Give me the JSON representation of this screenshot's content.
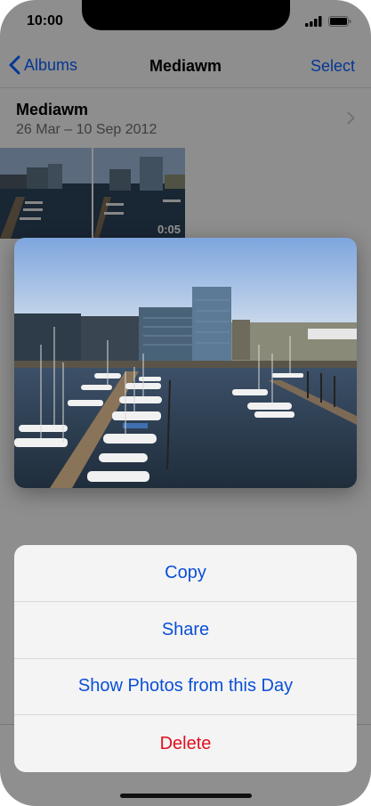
{
  "status_bar": {
    "time": "10:00"
  },
  "nav": {
    "back_label": "Albums",
    "title": "Mediawm",
    "select_label": "Select"
  },
  "album": {
    "title": "Mediawm",
    "dates": "26 Mar – 10 Sep 2012"
  },
  "thumbnails": [
    {
      "duration": ""
    },
    {
      "duration": "0:05"
    }
  ],
  "action_sheet": {
    "items": [
      {
        "label": "Copy"
      },
      {
        "label": "Share"
      },
      {
        "label": "Show Photos from this Day"
      },
      {
        "label": "Delete",
        "destructive": true
      }
    ]
  },
  "colors": {
    "accent": "#0a60ff",
    "action_text": "#0a4fd6",
    "destructive": "#e0101e"
  },
  "icons": [
    "chevron-left-icon",
    "chevron-right-icon",
    "signal-icon",
    "battery-icon"
  ]
}
